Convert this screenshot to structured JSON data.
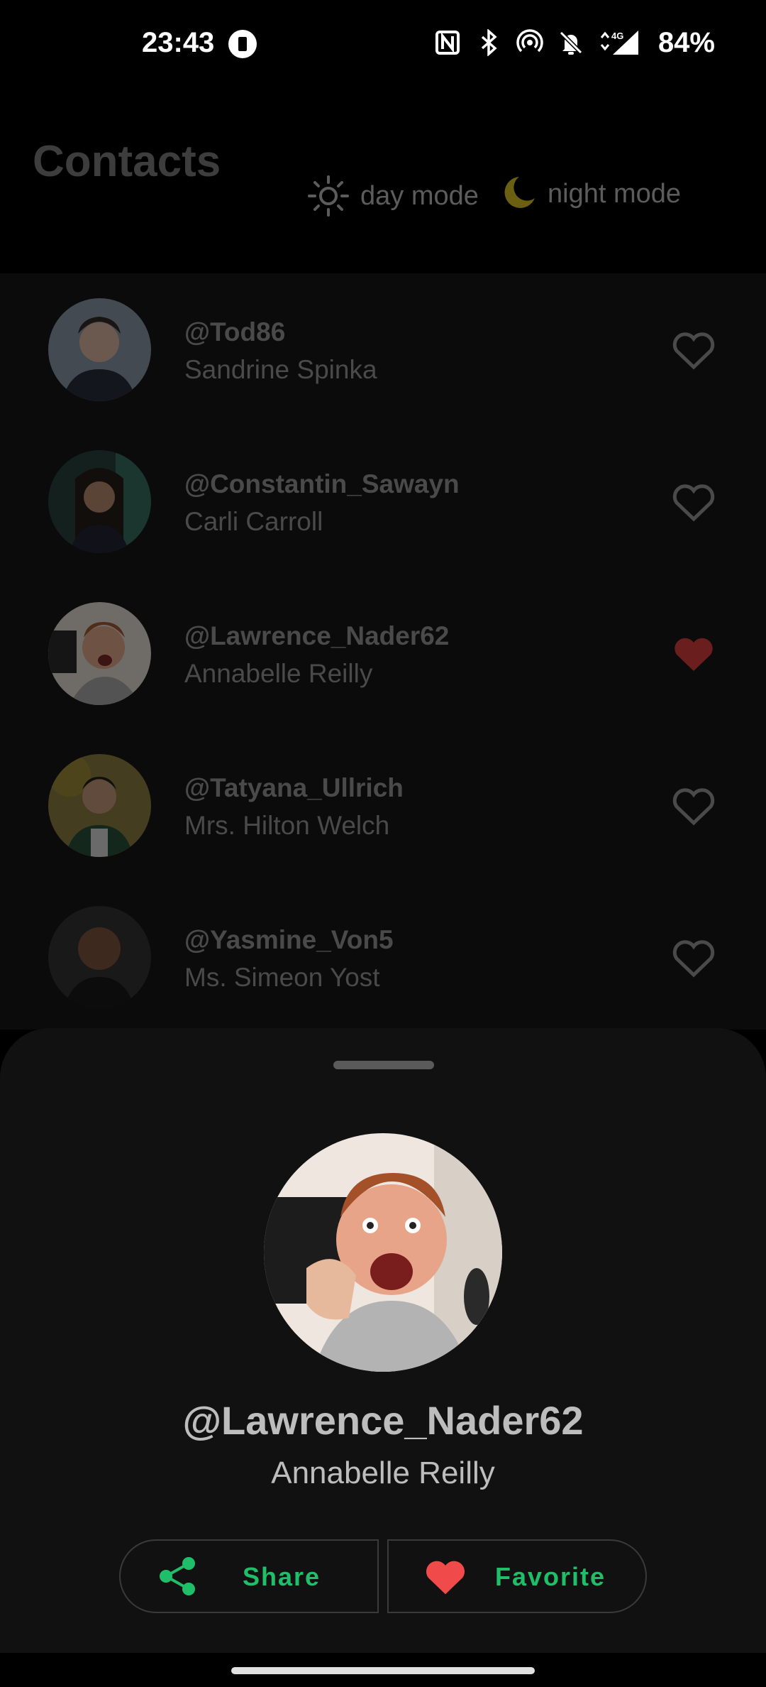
{
  "status_bar": {
    "time": "23:43",
    "battery": "84%",
    "icons": [
      "nfc-icon",
      "bluetooth-icon",
      "hotspot-icon",
      "bell-off-icon",
      "signal-4g-icon"
    ]
  },
  "header": {
    "title": "Contacts",
    "day_mode_label": "day mode",
    "night_mode_label": "night mode"
  },
  "contacts": [
    {
      "handle": "@Tod86",
      "name": "Sandrine Spinka",
      "favorite": false
    },
    {
      "handle": "@Constantin_Sawayn",
      "name": "Carli Carroll",
      "favorite": false
    },
    {
      "handle": "@Lawrence_Nader62",
      "name": "Annabelle Reilly",
      "favorite": true
    },
    {
      "handle": "@Tatyana_Ullrich",
      "name": "Mrs. Hilton Welch",
      "favorite": false
    },
    {
      "handle": "@Yasmine_Von5",
      "name": "Ms. Simeon Yost",
      "favorite": false
    }
  ],
  "sheet": {
    "handle": "@Lawrence_Nader62",
    "name": "Annabelle Reilly",
    "share_label": "Share",
    "favorite_label": "Favorite"
  },
  "colors": {
    "accent": "#1fbf6a",
    "favorite": "#d94a4a",
    "moon": "#b8a21a"
  }
}
